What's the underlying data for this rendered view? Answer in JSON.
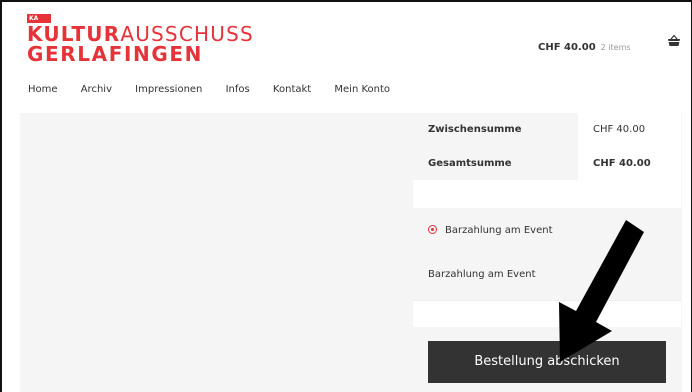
{
  "header": {
    "logo_badge": "KA",
    "logo_word1_bold": "KULTUR",
    "logo_word1_thin": "AUSSCHUSS",
    "logo_word2": "GERLAFINGEN",
    "cart_price": "CHF 40.00",
    "cart_count": "2 items",
    "cart_icon": "basket-icon"
  },
  "nav": {
    "items": [
      "Home",
      "Archiv",
      "Impressionen",
      "Infos",
      "Kontakt",
      "Mein Konto"
    ]
  },
  "summary": {
    "subtotal_label": "Zwischensumme",
    "subtotal_value": "CHF 40.00",
    "total_label": "Gesamtsumme",
    "total_value": "CHF 40.00"
  },
  "payment": {
    "option_label": "Barzahlung am Event",
    "description": "Barzahlung am Event",
    "selected": true
  },
  "submit_label": "Bestellung abschicken",
  "colors": {
    "brand_red": "#e63339",
    "button_bg": "#333333",
    "panel_bg": "#f5f5f5"
  }
}
